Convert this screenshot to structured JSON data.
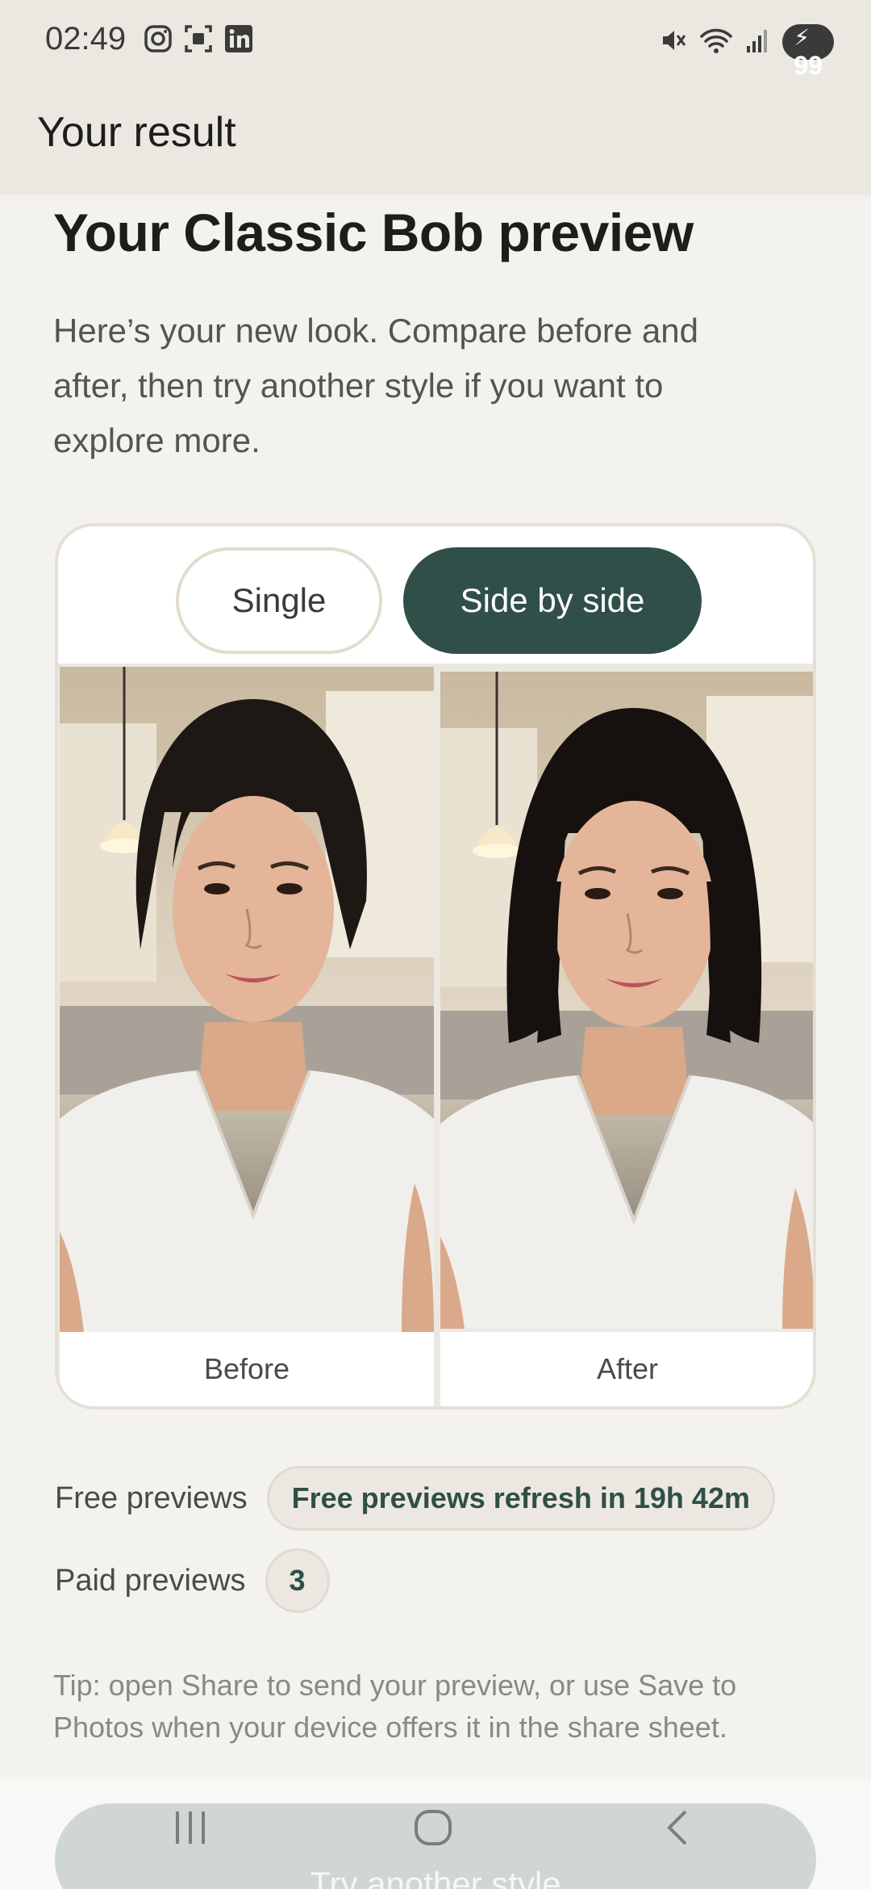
{
  "status_bar": {
    "time": "02:49",
    "battery": "99",
    "left_icons": [
      "instagram-icon",
      "screenshot-icon",
      "linkedin-icon"
    ],
    "right_icons": [
      "mute-icon",
      "wifi-icon",
      "signal-icon",
      "battery-icon"
    ]
  },
  "app_bar": {
    "title": "Your result"
  },
  "main": {
    "heading": "Your Classic Bob preview",
    "intro": "Here’s your new look. Compare before and after, then try another style if you want to explore more.",
    "toggle": {
      "single_label": "Single",
      "side_label": "Side by side",
      "selected": "Side by side"
    },
    "compare": {
      "before_label": "Before",
      "after_label": "After"
    },
    "free_previews": {
      "label": "Free previews",
      "value": "Free previews refresh in 19h 42m"
    },
    "paid_previews": {
      "label": "Paid previews",
      "value": "3"
    },
    "tip": "Tip: open Share to send your preview, or use Save to Photos when your device offers it in the share sheet.",
    "cta_label": "Try another style"
  },
  "colors": {
    "accent": "#2f4f48",
    "background": "#f3f2ef",
    "app_bar": "#ebe8e2",
    "cta_disabled": "#cfd6d5"
  },
  "nav_bar": {
    "icons": [
      "recent-apps-icon",
      "home-icon",
      "back-icon"
    ]
  }
}
